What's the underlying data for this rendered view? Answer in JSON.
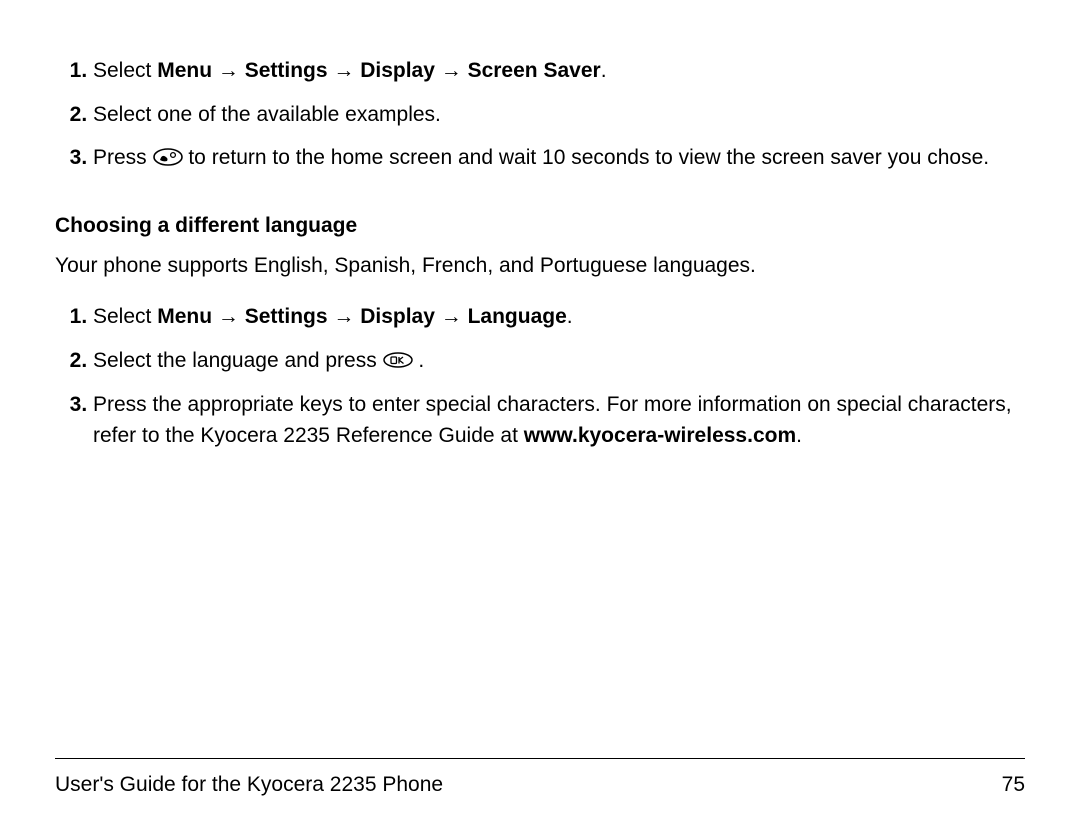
{
  "list1": {
    "item1_prefix": "Select ",
    "item1_bold": "Menu → Settings → Display → Screen Saver",
    "item1_suffix": ".",
    "item2": "Select one of the available examples.",
    "item3_before": "Press ",
    "item3_after": " to return to the home screen and wait 10 seconds to view the screen saver you chose."
  },
  "heading": "Choosing a different language",
  "intro": "Your phone supports English, Spanish, French, and Portuguese languages.",
  "list2": {
    "item1_prefix": "Select ",
    "item1_bold": "Menu → Settings → Display → Language",
    "item1_suffix": ".",
    "item2_before": "Select the language and press ",
    "item2_after": " .",
    "item3_before": "Press the appropriate keys to enter special characters. For more information on special characters, refer to the Kyocera 2235 Reference Guide at ",
    "item3_bold": "www.kyocera-wireless.com",
    "item3_suffix": "."
  },
  "footer": {
    "title": "User's Guide for the Kyocera 2235 Phone",
    "page": "75"
  }
}
